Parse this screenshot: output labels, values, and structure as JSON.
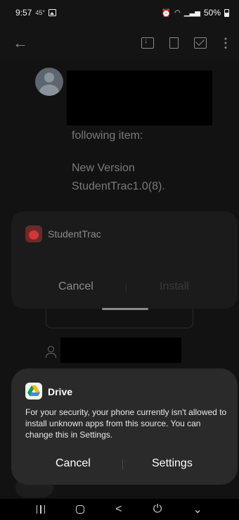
{
  "status_bar": {
    "time": "9:57",
    "extra": "45°",
    "battery": "50%"
  },
  "toolbar": {
    "back_icon": "arrow-left-icon",
    "archive_icon": "archive-icon",
    "trash_icon": "trash-icon",
    "mail_icon": "mail-icon",
    "more_icon": "more-vert-icon"
  },
  "email": {
    "line1": "following item:",
    "line2": "New Version",
    "line3": "StudentTrac1.0(8)."
  },
  "install_sheet": {
    "app_name": "StudentTrac",
    "cancel_label": "Cancel",
    "install_label": "Install"
  },
  "dialog": {
    "app_name": "Drive",
    "message": "For your security, your phone currently isn't allowed to install unknown apps from this source. You can change this in Settings.",
    "cancel_label": "Cancel",
    "settings_label": "Settings"
  },
  "navbar": {
    "back_glyph": "<",
    "power_glyph": "⏻",
    "down_glyph": "⌄"
  },
  "colors": {
    "dialog_bg": "#2a2a2a",
    "sheet_bg": "#1b1b1b",
    "content_bg": "#121212"
  }
}
